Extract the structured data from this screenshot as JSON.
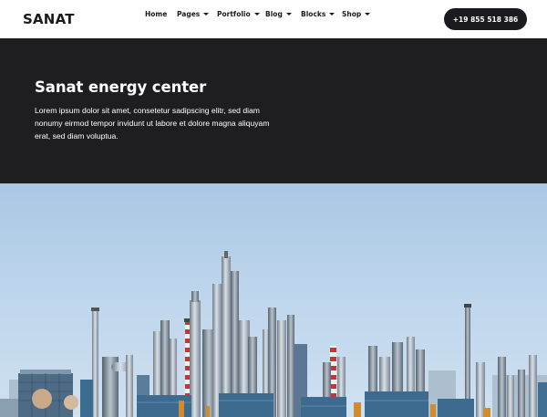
{
  "header": {
    "logo": "SANAT",
    "nav": [
      {
        "label": "Home",
        "dropdown": false
      },
      {
        "label": "Pages",
        "dropdown": true
      },
      {
        "label": "Portfolio",
        "dropdown": true
      },
      {
        "label": "Blog",
        "dropdown": true
      },
      {
        "label": "Blocks",
        "dropdown": true
      },
      {
        "label": "Shop",
        "dropdown": true
      }
    ],
    "phone": "+19 855 518 386"
  },
  "hero": {
    "title": "Sanat energy center",
    "text": "Lorem ipsum dolor sit amet, consetetur sadipscing elitr, sed diam nonumy eirmod tempor invidunt ut labore et dolore magna aliquyam erat, sed diam voluptua."
  },
  "colors": {
    "hero_bg": "#1e1e21",
    "button_bg": "#1b1b1f",
    "text_dark": "#1b1b1f",
    "sky": "#bdd5ec"
  }
}
